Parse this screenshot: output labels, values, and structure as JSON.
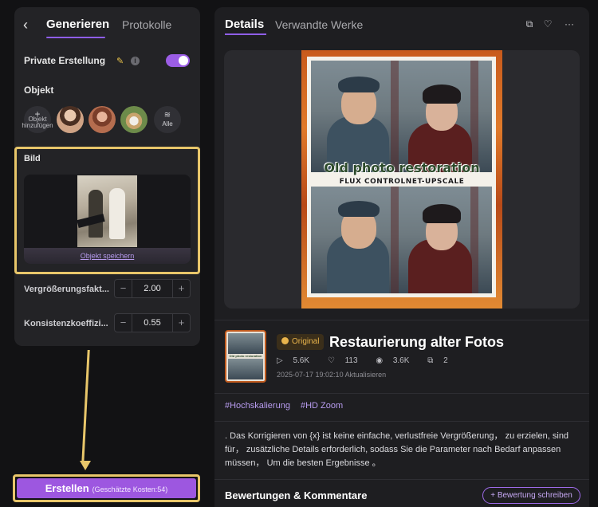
{
  "left": {
    "tabs": {
      "generate": "Generieren",
      "logs": "Protokolle"
    },
    "private_label": "Private Erstellung",
    "object_label": "Objekt",
    "object_add_label": "Objekt hinzufügen",
    "object_all_label": "Alle",
    "image_label": "Bild",
    "save_object_link": "Objekt speichern",
    "params": [
      {
        "label": "Vergrößerungsfakt...",
        "value": "2.00"
      },
      {
        "label": "Konsistenzkoeffizi...",
        "value": "0.55"
      }
    ],
    "create_button": {
      "label": "Erstellen",
      "cost": "(Geschätzte Kosten:54)"
    }
  },
  "right": {
    "tabs": {
      "details": "Details",
      "related": "Verwandte Werke"
    },
    "poster_title": "Old photo restoration",
    "poster_subtitle": "FLUX CONTROLNET-UPSCALE",
    "thumb_text": "Old photo restoration",
    "badge": "Original",
    "work_title": "Restaurierung alter Fotos",
    "stats": {
      "plays": "5.6K",
      "likes": "113",
      "views": "3.6K",
      "shares": "2"
    },
    "date": "2025-07-17 19:02:10 Aktualisieren",
    "tags": [
      "#Hochskalierung",
      "#HD Zoom"
    ],
    "description": ". Das Korrigieren von {x} ist keine einfache, verlustfreie Vergrößerung， zu erzielen, sind für， zusätzliche Details erforderlich, sodass Sie die Parameter nach Bedarf anpassen müssen， Um die besten Ergebnisse 。",
    "comments_title": "Bewertungen & Kommentare",
    "rate_button": "+ Bewertung schreiben"
  },
  "colors": {
    "accent": "#9d57e0",
    "highlight": "#e8c66a",
    "badge": "#e9b44c"
  },
  "icons": [
    "back-icon",
    "wand-icon",
    "info-icon",
    "toggle-switch",
    "plus-icon",
    "layers-icon",
    "share-icon",
    "heart-icon",
    "more-icon",
    "play-icon",
    "eye-icon"
  ]
}
